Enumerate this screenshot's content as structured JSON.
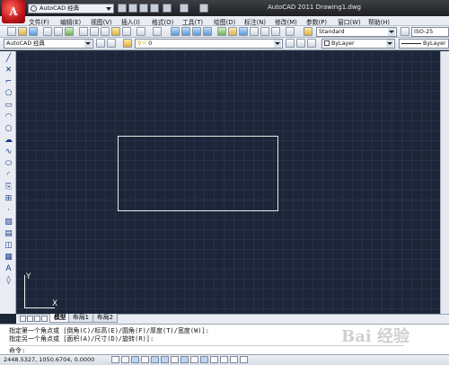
{
  "app": {
    "workspace": "AutoCAD 经典",
    "window_title": "AutoCAD 2011    Drawing1.dwg",
    "logo_letter": "A"
  },
  "menu": [
    "文件(F)",
    "编辑(E)",
    "视图(V)",
    "插入(I)",
    "格式(O)",
    "工具(T)",
    "绘图(D)",
    "标注(N)",
    "修改(M)",
    "参数(P)",
    "窗口(W)",
    "帮助(H)"
  ],
  "toolbar": {
    "text_style": "Standard",
    "dim_style": "ISO-25",
    "workspace2": "AutoCAD 经典",
    "layer": "0",
    "color": "ByLayer",
    "linetype": "ByLayer"
  },
  "ucs": {
    "x_label": "X",
    "y_label": "Y"
  },
  "tabs": [
    "模型",
    "布局1",
    "布局2"
  ],
  "command": {
    "line1": "指定第一个角点或 [倒角(C)/标高(E)/圆角(F)/厚度(T)/宽度(W)]:",
    "line2": "指定另一个角点或 [面积(A)/尺寸(D)/旋转(R)]:",
    "prompt": "命令:"
  },
  "status": {
    "coordinates": "2448.5327,  1050.6704, 0.0000"
  },
  "watermark": "Bai 经验"
}
